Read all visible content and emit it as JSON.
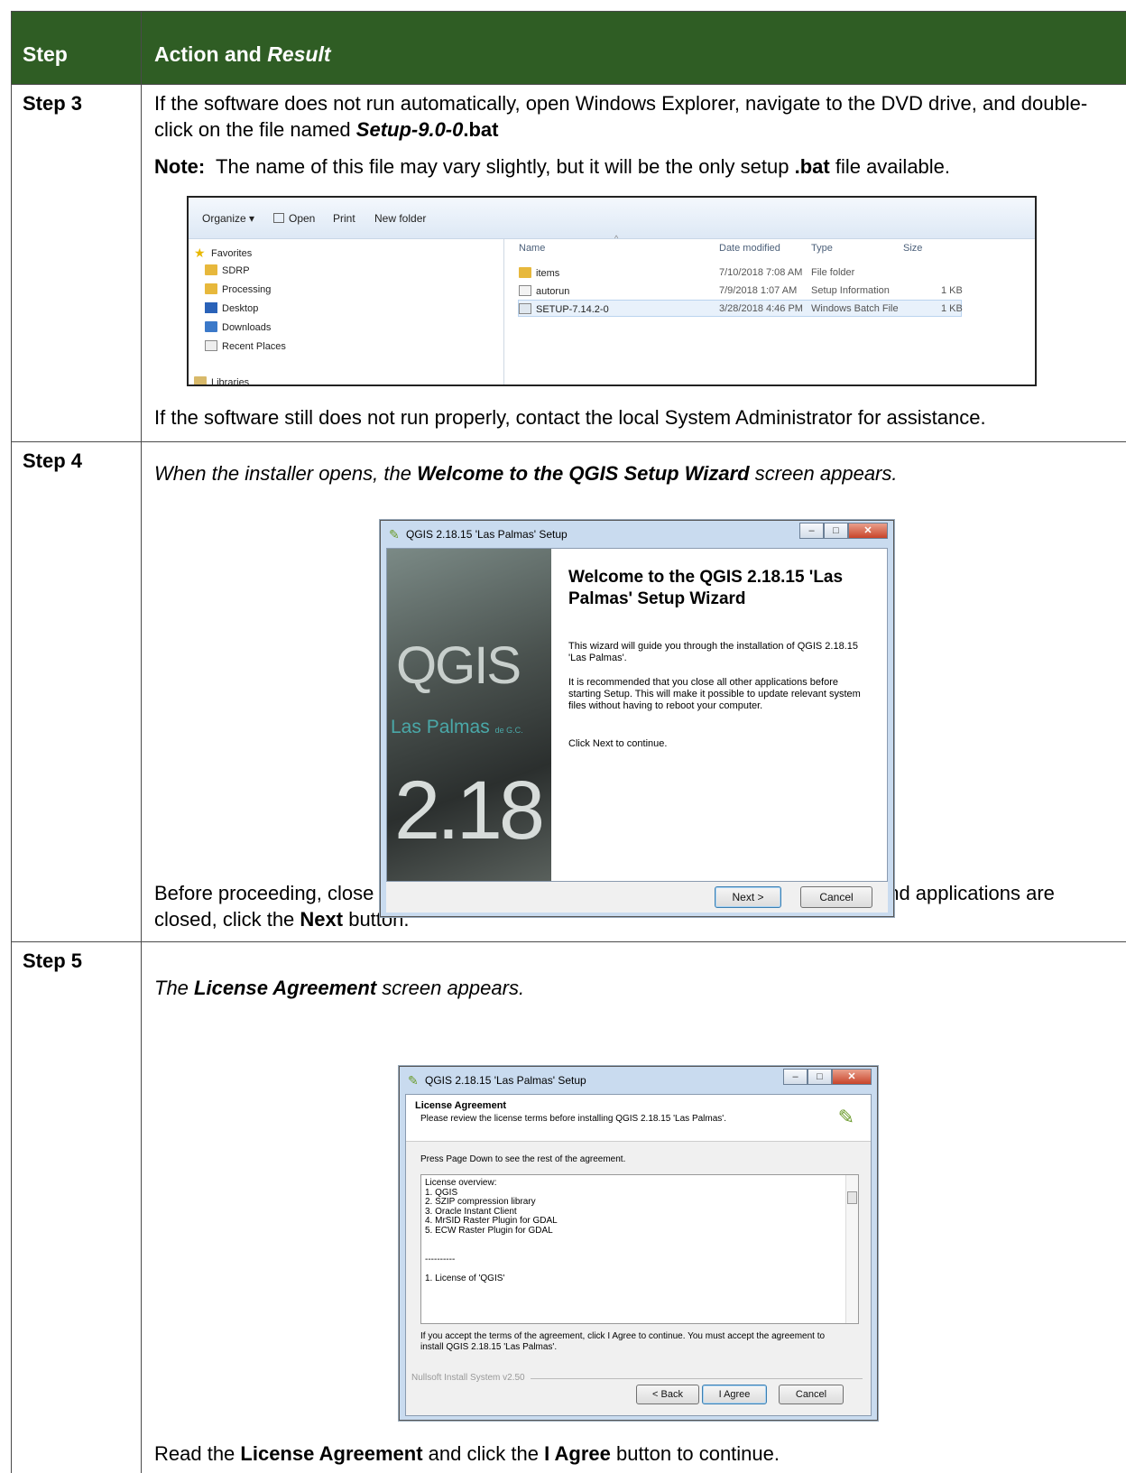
{
  "table": {
    "col_step": "Step",
    "col_action_a": "Action and ",
    "col_action_b": "Result"
  },
  "step3": {
    "label": "Step 3",
    "para1_a": "If the software does not run automatically, open Windows Explorer, navigate to the DVD drive, and double-click on the file named ",
    "para1_b": "Setup-9.0-0",
    "para1_c": ".bat",
    "note_label": "Note:",
    "note_a": "  The name of this file may vary slightly, but it will be the only setup ",
    "note_b": ".bat",
    "note_c": " file available.",
    "para2": "If the software still does not run properly, contact the local System Administrator for assistance."
  },
  "explorer": {
    "toolbar": {
      "organize": "Organize ▾",
      "open": "Open",
      "print": "Print",
      "new_folder": "New folder"
    },
    "nav": {
      "favorites": "Favorites",
      "items": [
        "SDRP",
        "Processing",
        "Desktop",
        "Downloads",
        "Recent Places"
      ],
      "libraries": "Libraries"
    },
    "columns": {
      "name": "Name",
      "date": "Date modified",
      "type": "Type",
      "size": "Size"
    },
    "files": [
      {
        "name": "items",
        "date": "7/10/2018 7:08 AM",
        "type": "File folder",
        "size": ""
      },
      {
        "name": "autorun",
        "date": "7/9/2018 1:07 AM",
        "type": "Setup Information",
        "size": "1 KB"
      },
      {
        "name": "SETUP-7.14.2-0",
        "date": "3/28/2018 4:46 PM",
        "type": "Windows Batch File",
        "size": "1 KB"
      }
    ]
  },
  "step4": {
    "label": "Step 4",
    "intro_a": "When the installer opens, the ",
    "intro_b": "Welcome to the QGIS Setup Wizard",
    "intro_c": " screen appears.",
    "after_a": "Before proceeding, close all other programs or applications. Once other programs and applications are closed, click the ",
    "after_b": "Next",
    "after_c": " button."
  },
  "welcome_dialog": {
    "title": "QGIS 2.18.15 'Las Palmas' Setup",
    "heading": "Welcome to the QGIS 2.18.15 'Las Palmas' Setup Wizard",
    "p1": "This wizard will guide you through the installation of QGIS 2.18.15 'Las Palmas'.",
    "p2": "It is recommended that you close all other applications before starting Setup. This will make it possible to update relevant system files without having to reboot your computer.",
    "p3": "Click Next to continue.",
    "splash_q": "QGIS",
    "splash_place": "Las Palmas",
    "splash_small": "de G.C.",
    "splash_ver": "2.18",
    "next": "Next >",
    "cancel": "Cancel"
  },
  "step5": {
    "label": "Step 5",
    "intro_a": "The ",
    "intro_b": "License Agreement",
    "intro_c": " screen appears.",
    "after_a": "Read the ",
    "after_b": "License Agreement",
    "after_c": " and click the ",
    "after_d": "I Agree",
    "after_e": " button to continue."
  },
  "license_dialog": {
    "title": "QGIS 2.18.15 'Las Palmas' Setup",
    "heading": "License Agreement",
    "sub": "Please review the license terms before installing QGIS 2.18.15 'Las Palmas'.",
    "press": "Press Page Down to see the rest of the agreement.",
    "lines": [
      "License overview:",
      "1. QGIS",
      "2. SZIP compression library",
      "3. Oracle Instant Client",
      "4. MrSID Raster Plugin for GDAL",
      "5. ECW Raster Plugin for GDAL",
      "",
      "",
      "----------",
      "",
      "1. License of 'QGIS'"
    ],
    "accept": "If you accept the terms of the agreement, click I Agree to continue. You must accept the agreement to install QGIS 2.18.15 'Las Palmas'.",
    "nullsoft": "Nullsoft Install System v2.50",
    "back": "< Back",
    "agree": "I Agree",
    "cancel": "Cancel"
  }
}
